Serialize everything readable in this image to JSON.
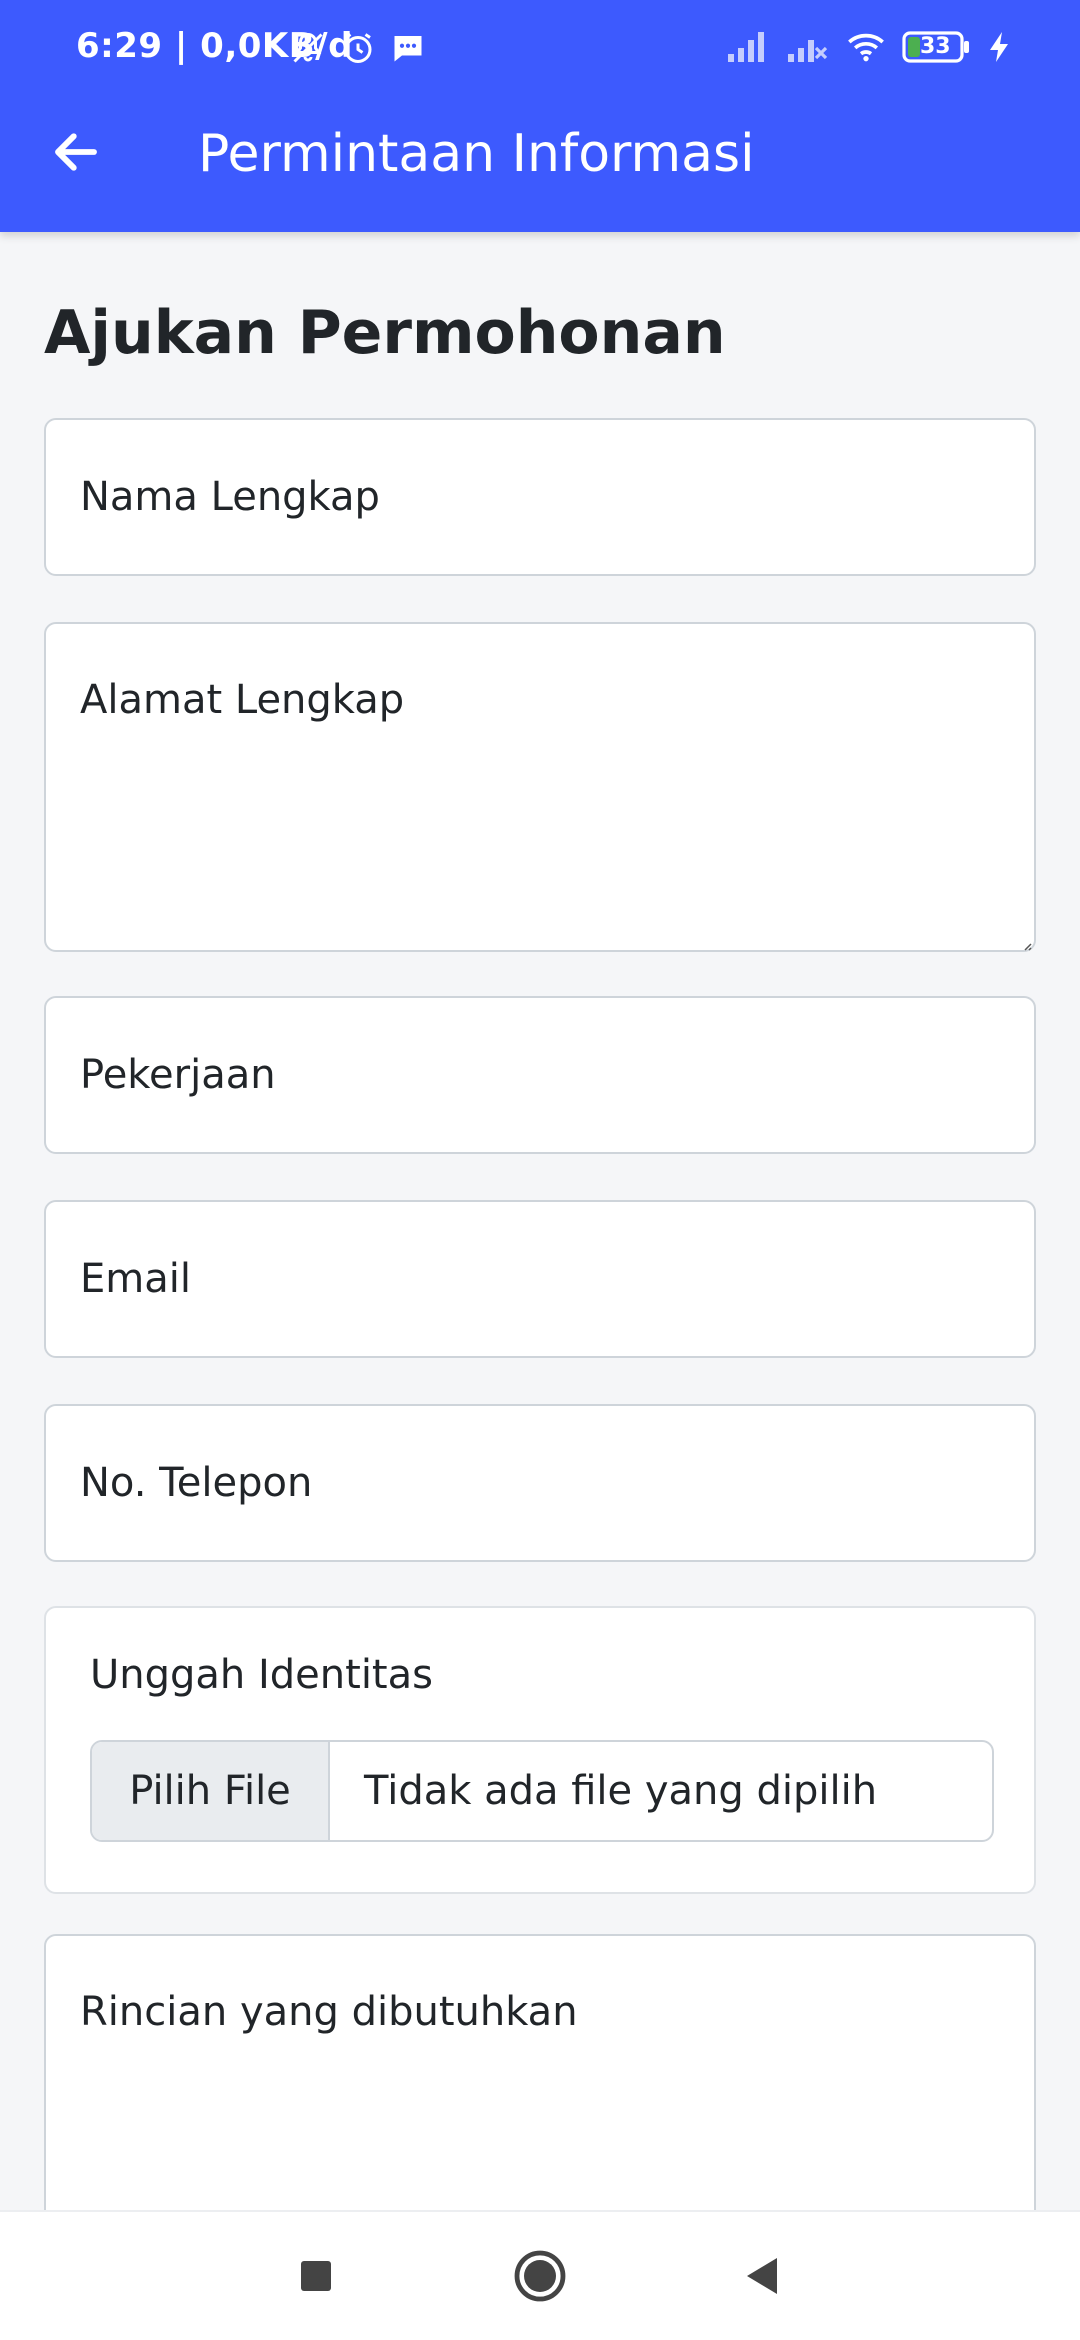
{
  "status_bar": {
    "time": "6:29 | 0,0KB/d",
    "battery": "33",
    "icons": [
      "bell-off-icon",
      "alarm-icon",
      "message-icon",
      "signal-icon",
      "signal-off-icon",
      "wifi-icon",
      "battery-icon",
      "charging-icon"
    ]
  },
  "app_bar": {
    "title": "Permintaan Informasi",
    "back_icon": "arrow-left-icon",
    "color": "#3d5afe"
  },
  "form": {
    "heading": "Ajukan Permohonan",
    "fields": {
      "nama_placeholder": "Nama Lengkap",
      "alamat_placeholder": "Alamat Lengkap",
      "pekerjaan_placeholder": "Pekerjaan",
      "email_placeholder": "Email",
      "telepon_placeholder": "No. Telepon",
      "rincian_placeholder": "Rincian yang dibutuhkan"
    },
    "upload": {
      "label": "Unggah Identitas",
      "button_label": "Pilih File",
      "status": "Tidak ada file yang dipilih"
    }
  },
  "nav_bar": {
    "icons": [
      "recent-apps-icon",
      "home-icon",
      "back-icon"
    ]
  }
}
